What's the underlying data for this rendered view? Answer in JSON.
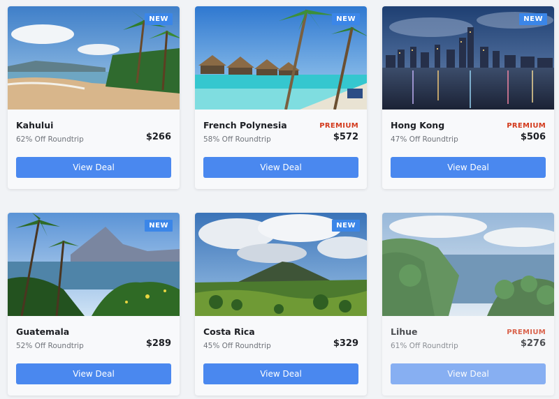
{
  "deals": [
    {
      "destination": "Kahului",
      "discount": "62% Off Roundtrip",
      "price": "$266",
      "badge": "NEW",
      "tier": "",
      "button": "View Deal"
    },
    {
      "destination": "French Polynesia",
      "discount": "58% Off Roundtrip",
      "price": "$572",
      "badge": "NEW",
      "tier": "PREMIUM",
      "button": "View Deal"
    },
    {
      "destination": "Hong Kong",
      "discount": "47% Off Roundtrip",
      "price": "$506",
      "badge": "NEW",
      "tier": "PREMIUM",
      "button": "View Deal"
    },
    {
      "destination": "Guatemala",
      "discount": "52% Off Roundtrip",
      "price": "$289",
      "badge": "NEW",
      "tier": "",
      "button": "View Deal"
    },
    {
      "destination": "Costa Rica",
      "discount": "45% Off Roundtrip",
      "price": "$329",
      "badge": "NEW",
      "tier": "",
      "button": "View Deal"
    },
    {
      "destination": "Lihue",
      "discount": "61% Off Roundtrip",
      "price": "$276",
      "badge": "",
      "tier": "PREMIUM",
      "button": "View Deal"
    }
  ],
  "colors": {
    "accent": "#4a88ef",
    "badge": "#3b86e8",
    "premium": "#d33a1c"
  }
}
